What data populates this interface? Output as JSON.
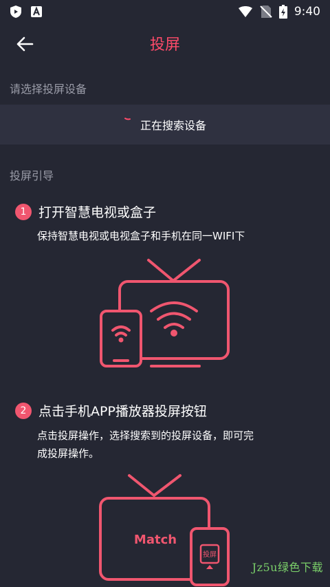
{
  "status_bar": {
    "time": "9:40",
    "icons": [
      "shield-play-icon",
      "a-badge-icon",
      "wifi-icon",
      "no-sim-icon",
      "battery-charging-icon"
    ]
  },
  "header": {
    "title": "投屏",
    "back_icon": "arrow-left-icon"
  },
  "device_section": {
    "label": "请选择投屏设备",
    "searching_text": "正在搜索设备"
  },
  "guide": {
    "label": "投屏引导",
    "steps": [
      {
        "number": "1",
        "title": "打开智慧电视或盒子",
        "desc": "保持智慧电视或电视盒子和手机在同一WIFI下"
      },
      {
        "number": "2",
        "title": "点击手机APP播放器投屏按钮",
        "desc_line1": "点击投屏操作，选择搜索到的投屏设备，即可完",
        "desc_line2": "成投屏操作。"
      }
    ]
  },
  "illustration_2": {
    "tv_text": "Match",
    "phone_button": "投屏"
  },
  "watermark": "Jz5u绿色下载",
  "colors": {
    "background": "#252733",
    "accent": "#ff4b6a",
    "row_bg": "#2f3140",
    "muted_text": "#9a9ca8"
  }
}
